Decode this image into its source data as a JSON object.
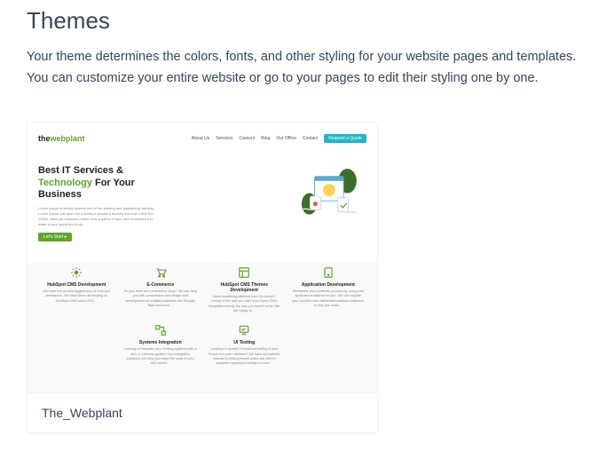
{
  "header": {
    "title": "Themes",
    "description": "Your theme determines the colors, fonts, and other styling for your website pages and templates. You can customize your entire website or go to your pages to edit their styling one by one."
  },
  "themeCard": {
    "name": "The_Webplant"
  },
  "miniSite": {
    "logoPrefix": "the",
    "logoMain": "webplant",
    "nav": [
      "About Us",
      "Services",
      "Careers",
      "Blog",
      "Our Office",
      "Contact"
    ],
    "navCta": "Request a Quote",
    "hero": {
      "line1": "Best IT Services &",
      "accent": "Technology",
      "line2rest": " For Your",
      "line3": "Business",
      "sub": "Lorem ipsum is simply dummy text of the printing and typesetting industry. Lorem ipsum has been the industry's standard dummy text ever since the 1500s, when an unknown printer took a galley of type and scrambled it to make a type specimen book.",
      "cta": "Let's Start ▸"
    },
    "features_row1": [
      {
        "title": "HubSpot CMS Development",
        "desc": "We have the world's biggest pool of HubSpot developers. We have been developing on HubSpot CMS since 2011…"
      },
      {
        "title": "E-Commerce",
        "desc": "Do you have an e-commerce shop? We can help you with consultation and design and development on multiple platforms like Shopify, BigCommerce…"
      },
      {
        "title": "HubSpot CMS Themes Development",
        "desc": "Want something different from the bunch? Design it the way you want your frybot CMS templates exactly the way you want it to be. We are happy to…"
      },
      {
        "title": "Application Development",
        "desc": "Streamline your business process by using web applications tailored for you. We can migrate your process onto distributed software platforms to help you scale…"
      }
    ],
    "features_row2": [
      {
        "title": "Systems Integration",
        "desc": "Looking to integrate your existing systems with a new or external system? Our integration solutions can help you make the most of your web-based…"
      },
      {
        "title": "UI Testing",
        "desc": "Looking for quality? Functional testing of your brand new user interface? We have specialized manual UI testing teams which are able to complete regression testing to cover…"
      }
    ]
  }
}
